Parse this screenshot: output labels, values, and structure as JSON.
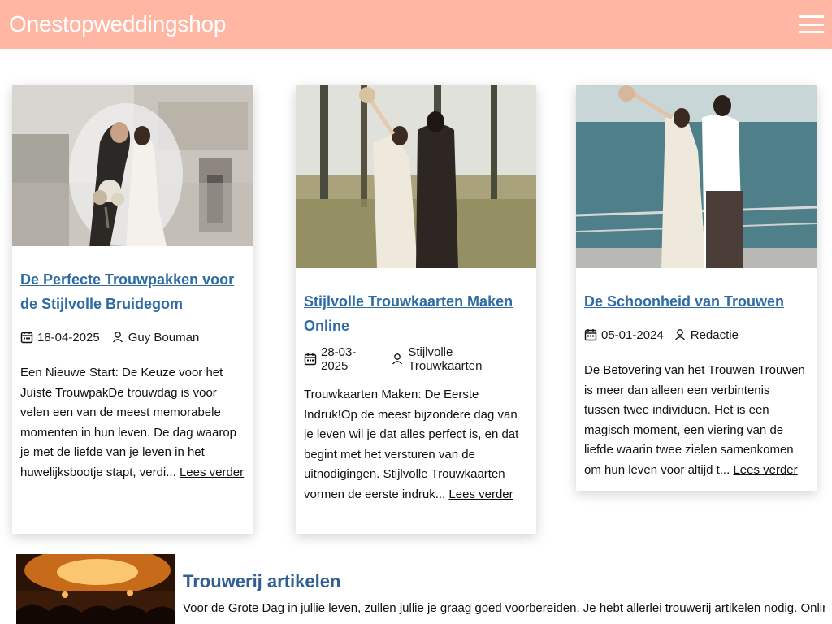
{
  "site": {
    "title": "Onestopweddingshop"
  },
  "cards": [
    {
      "title": "De Perfecte Trouwpakken voor de Stijlvolle Bruidegom",
      "date": "18-04-2025",
      "author": "Guy Bouman",
      "excerpt": "Een Nieuwe Start: De Keuze voor het Juiste TrouwpakDe trouwdag is voor velen een van de meest memorabele momenten in hun leven. De dag waarop je met de liefde van je leven in het huwelijksbootje stapt, verdi... ",
      "read_more": "Lees verder"
    },
    {
      "title": "Stijlvolle Trouwkaarten Maken Online",
      "date": "28-03-2025",
      "author": "Stijlvolle Trouwkaarten",
      "excerpt": "Trouwkaarten Maken: De Eerste Indruk!Op de meest bijzondere dag van je leven wil je dat alles perfect is, en dat begint met het versturen van de uitnodigingen. Stijlvolle Trouwkaarten vormen de eerste indruk... ",
      "read_more": "Lees verder"
    },
    {
      "title": "De Schoonheid van Trouwen",
      "date": "05-01-2024",
      "author": "Redactie",
      "excerpt": "De Betovering van het Trouwen Trouwen is meer dan alleen een verbintenis tussen twee individuen. Het is een magisch moment, een viering van de liefde waarin twee zielen samenkomen om hun leven voor altijd t... ",
      "read_more": "Lees verder"
    }
  ],
  "bottom_article": {
    "title": "Trouwerij artikelen",
    "text": "Voor de Grote Dag in jullie leven, zullen jullie je graag goed voorbereiden. Je hebt allerlei trouwerij artikelen nodig. Online"
  },
  "colors": {
    "header_bg": "#ffb6a2",
    "link": "#2f6ca3",
    "heading": "#2f5f93"
  },
  "icons": [
    "hamburger-menu-icon",
    "calendar-icon",
    "user-icon"
  ]
}
